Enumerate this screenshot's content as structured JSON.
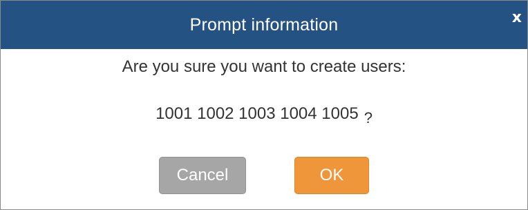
{
  "dialog": {
    "title": "Prompt information",
    "close_label": "x",
    "message_line1": "Are you sure you want to create users:",
    "message_users": "1001 1002 1003 1004 1005",
    "message_suffix": "?",
    "buttons": {
      "cancel_label": "Cancel",
      "ok_label": "OK"
    }
  },
  "colors": {
    "titlebar": "#245282",
    "cancel_button": "#a6a6a6",
    "ok_button": "#f0963a",
    "text": "#333333"
  }
}
